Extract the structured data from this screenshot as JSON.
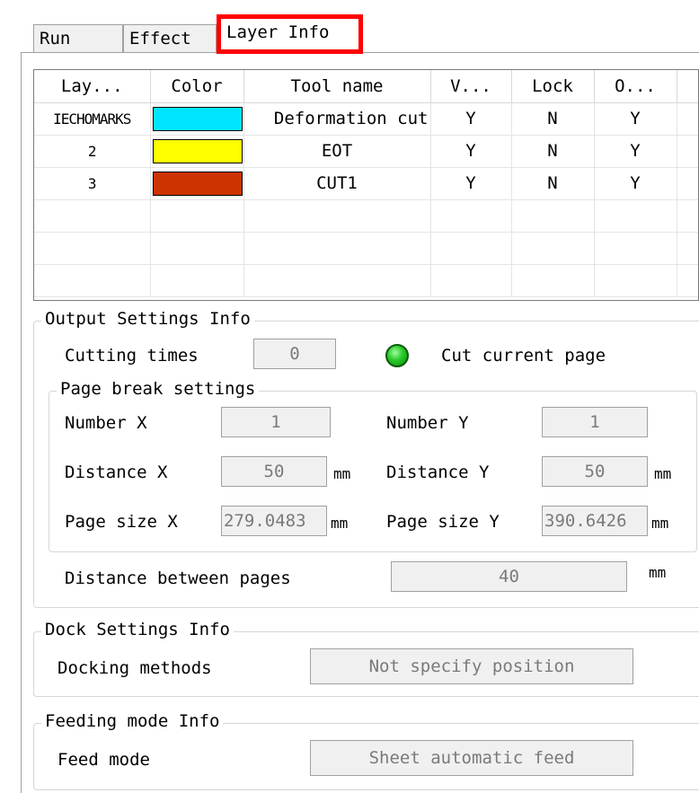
{
  "tabs": [
    {
      "label": "Run",
      "active": false
    },
    {
      "label": "Effect",
      "active": false
    },
    {
      "label": "Layer Info",
      "active": true,
      "highlight": "#ff0000"
    }
  ],
  "layer_table": {
    "columns": [
      "Lay...",
      "Color",
      "Tool name",
      "V...",
      "Lock",
      "O..."
    ],
    "rows": [
      {
        "layer": "IECHOMARKS",
        "color": "#00e5ff",
        "tool": "Deformation cut",
        "v": "Y",
        "lock": "N",
        "o": "Y"
      },
      {
        "layer": "2",
        "color": "#ffff00",
        "tool": "EOT",
        "v": "Y",
        "lock": "N",
        "o": "Y"
      },
      {
        "layer": "3",
        "color": "#cc3300",
        "tool": "CUT1",
        "v": "Y",
        "lock": "N",
        "o": "Y"
      }
    ]
  },
  "output_settings": {
    "title": "Output Settings Info",
    "cutting_times_label": "Cutting times",
    "cutting_times_value": "0",
    "cut_current_page_label": "Cut current page",
    "cut_current_page_on": true,
    "page_break": {
      "title": "Page break settings",
      "number_x_label": "Number X",
      "number_x_value": "1",
      "number_y_label": "Number Y",
      "number_y_value": "1",
      "distance_x_label": "Distance X",
      "distance_x_value": "50",
      "distance_y_label": "Distance Y",
      "distance_y_value": "50",
      "page_size_x_label": "Page size X",
      "page_size_x_value": "279.0483",
      "page_size_y_label": "Page size Y",
      "page_size_y_value": "390.6426",
      "unit": "mm"
    },
    "distance_between_pages_label": "Distance between pages",
    "distance_between_pages_value": "40",
    "unit": "mm"
  },
  "dock_settings": {
    "title": "Dock Settings Info",
    "docking_methods_label": "Docking methods",
    "docking_methods_value": "Not specify position"
  },
  "feeding_mode": {
    "title": "Feeding mode Info",
    "feed_mode_label": "Feed mode",
    "feed_mode_value": "Sheet automatic feed"
  }
}
